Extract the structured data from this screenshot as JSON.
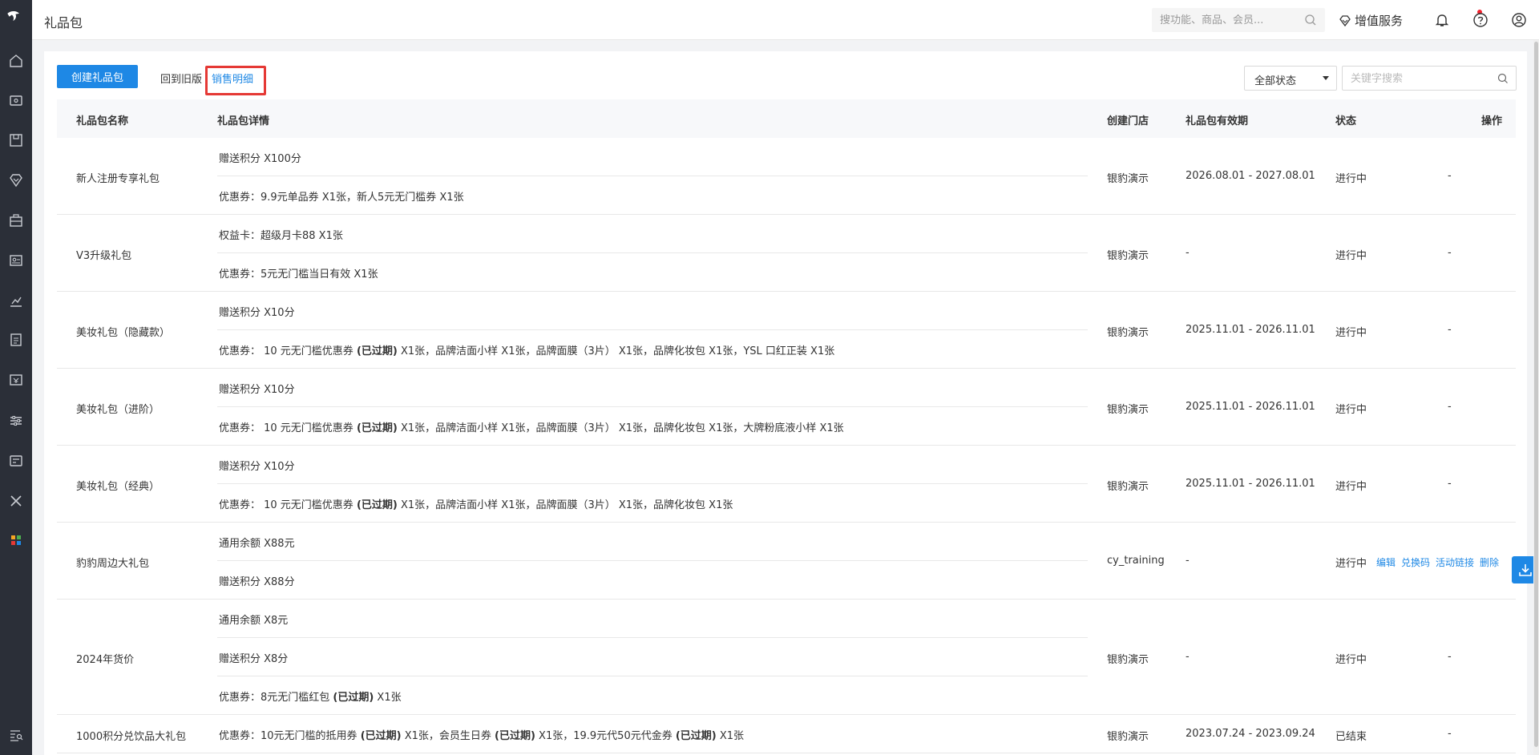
{
  "header": {
    "title": "礼品包",
    "search_placeholder": "搜功能、商品、会员...",
    "vip_label": "增值服务"
  },
  "toolbar": {
    "create_label": "创建礼品包",
    "back_old_label": "回到旧版",
    "sales_label": "销售明细",
    "status_selected": "全部状态",
    "keyword_placeholder": "关键字搜索"
  },
  "table": {
    "headers": {
      "name": "礼品包名称",
      "detail": "礼品包详情",
      "store": "创建门店",
      "validity": "礼品包有效期",
      "status": "状态",
      "ops": "操作"
    },
    "rows": [
      {
        "name": "新人注册专享礼包",
        "details": [
          {
            "text": "赠送积分 X100分"
          },
          {
            "text": "优惠券：9.9元单品券 X1张，新人5元无门槛券 X1张"
          }
        ],
        "store": "银豹演示",
        "validity": "2026.08.01 - 2027.08.01",
        "status": "进行中",
        "ops": "-"
      },
      {
        "name": "V3升级礼包",
        "details": [
          {
            "text": "权益卡：超级月卡88 X1张"
          },
          {
            "text": "优惠券：5元无门槛当日有效 X1张"
          }
        ],
        "store": "银豹演示",
        "validity": "-",
        "status": "进行中",
        "ops": "-"
      },
      {
        "name": "美妆礼包（隐藏款）",
        "details": [
          {
            "text": "赠送积分 X10分"
          },
          {
            "prefix": "优惠券：  10 元无门槛优惠券 ",
            "bold": "(已过期)",
            "suffix": " X1张，品牌洁面小样 X1张，品牌面膜（3片） X1张，品牌化妆包 X1张，YSL 口红正装 X1张"
          }
        ],
        "store": "银豹演示",
        "validity": "2025.11.01 - 2026.11.01",
        "status": "进行中",
        "ops": "-"
      },
      {
        "name": "美妆礼包（进阶）",
        "details": [
          {
            "text": "赠送积分 X10分"
          },
          {
            "prefix": "优惠券：  10 元无门槛优惠券 ",
            "bold": "(已过期)",
            "suffix": " X1张，品牌洁面小样 X1张，品牌面膜（3片） X1张，品牌化妆包 X1张，大牌粉底液小样 X1张"
          }
        ],
        "store": "银豹演示",
        "validity": "2025.11.01 - 2026.11.01",
        "status": "进行中",
        "ops": "-"
      },
      {
        "name": "美妆礼包（经典）",
        "details": [
          {
            "text": "赠送积分 X10分"
          },
          {
            "prefix": "优惠券：  10 元无门槛优惠券 ",
            "bold": "(已过期)",
            "suffix": " X1张，品牌洁面小样 X1张，品牌面膜（3片） X1张，品牌化妆包 X1张"
          }
        ],
        "store": "银豹演示",
        "validity": "2025.11.01 - 2026.11.01",
        "status": "进行中",
        "ops": "-"
      },
      {
        "name": "豹豹周边大礼包",
        "details": [
          {
            "text": "通用余额 X88元"
          },
          {
            "text": "赠送积分 X88分"
          }
        ],
        "store": "cy_training",
        "validity": "-",
        "status": "进行中",
        "ops_links": [
          "编辑",
          "兑换码",
          "活动链接",
          "删除"
        ]
      },
      {
        "name": "2024年货价",
        "details": [
          {
            "text": "通用余额 X8元"
          },
          {
            "text": "赠送积分 X8分"
          },
          {
            "prefix": "优惠券：8元无门槛红包 ",
            "bold": "(已过期)",
            "suffix": " X1张"
          }
        ],
        "store": "银豹演示",
        "validity": "-",
        "status": "进行中",
        "ops": "-"
      },
      {
        "name": "1000积分兑饮品大礼包",
        "details": [
          {
            "segments": [
              {
                "t": "优惠券：10元无门槛的抵用券 "
              },
              {
                "b": "(已过期)"
              },
              {
                "t": " X1张，会员生日券 "
              },
              {
                "b": "(已过期)"
              },
              {
                "t": " X1张，19.9元代50元代金券 "
              },
              {
                "b": "(已过期)"
              },
              {
                "t": " X1张"
              }
            ]
          }
        ],
        "store": "银豹演示",
        "validity": "2023.07.24 - 2023.09.24",
        "status": "已结束",
        "ops": "-"
      }
    ]
  }
}
